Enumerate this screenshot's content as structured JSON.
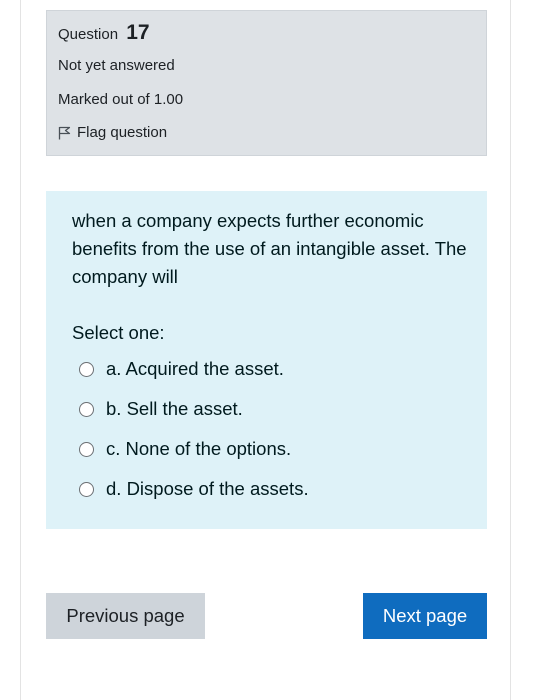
{
  "info": {
    "question_label": "Question",
    "question_number": "17",
    "status": "Not yet answered",
    "marks": "Marked out of 1.00",
    "flag_label": "Flag question",
    "flag_icon": "flag-icon"
  },
  "question": {
    "text": "when a company expects further economic benefits from the use of an intangible asset. The company will",
    "prompt": "Select one:",
    "options": [
      {
        "label": "a. Acquired the asset."
      },
      {
        "label": "b. Sell the asset."
      },
      {
        "label": "c. None of the options."
      },
      {
        "label": "d. Dispose of the assets."
      }
    ]
  },
  "nav": {
    "previous_label": "Previous page",
    "next_label": "Next page"
  },
  "colors": {
    "info_bg": "#dee2e6",
    "question_bg": "#def2f8",
    "next_button": "#0f6cbf",
    "previous_button": "#ced4da"
  }
}
